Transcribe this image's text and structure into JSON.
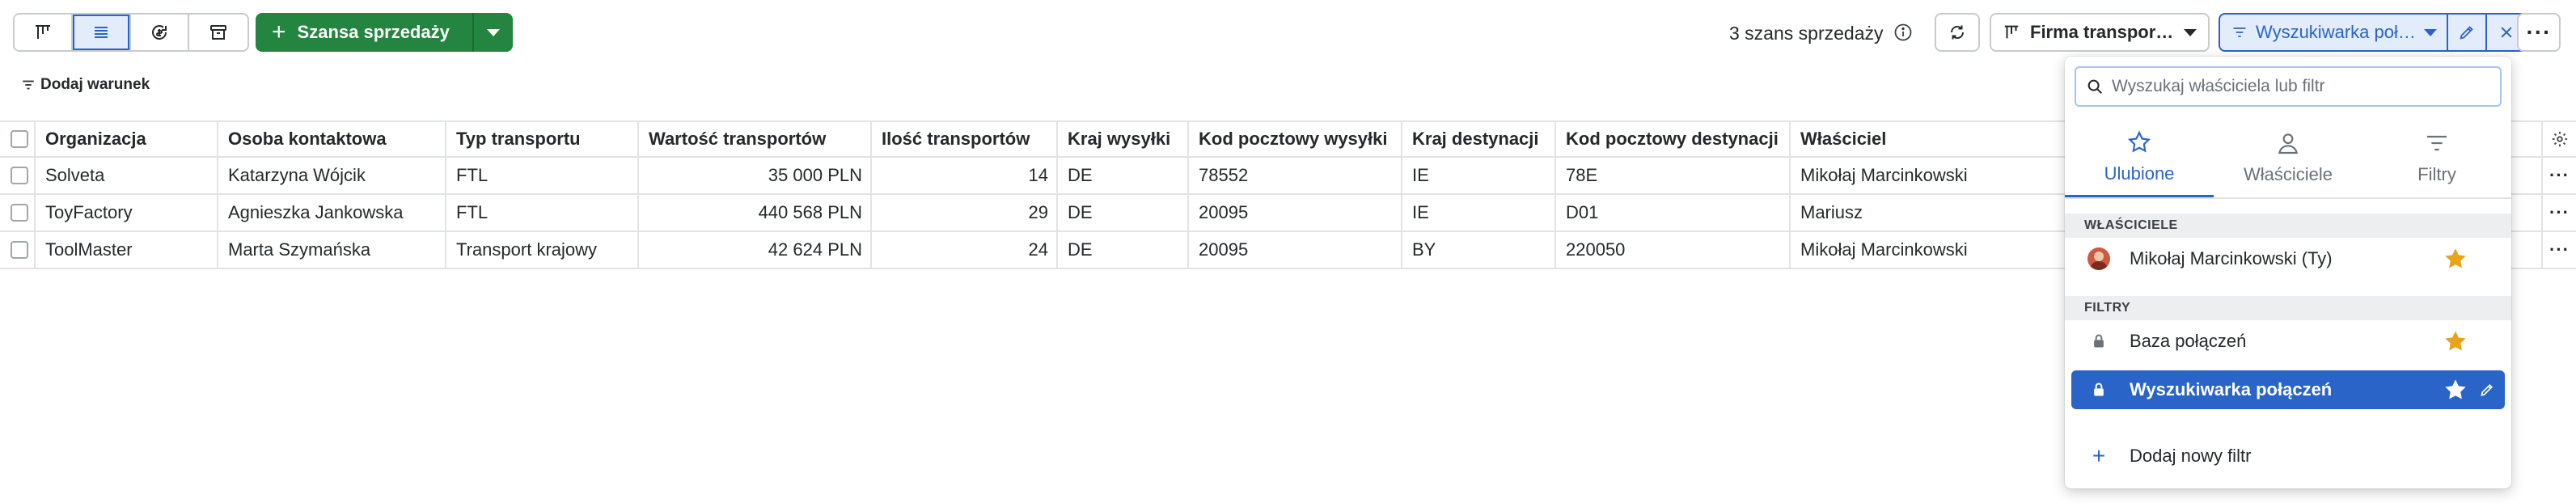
{
  "toolbar": {
    "views": [
      {
        "icon": "pipeline-board-icon",
        "active": false
      },
      {
        "icon": "list-view-icon",
        "active": true
      },
      {
        "icon": "forecast-icon",
        "active": false
      },
      {
        "icon": "archive-icon",
        "active": false
      }
    ],
    "add_deal_label": "Szansa sprzedaży",
    "deal_count": "3 szans sprzedaży",
    "pipeline_label": "Firma transportowa",
    "filter_label": "Wyszukiwarka połączeń",
    "more_label": "···"
  },
  "add_condition_label": "Dodaj warunek",
  "table": {
    "columns": [
      "Organizacja",
      "Osoba kontaktowa",
      "Typ transportu",
      "Wartość transportów",
      "Ilość transportów",
      "Kraj wysyłki",
      "Kod pocztowy wysyłki",
      "Kraj destynacji",
      "Kod pocztowy destynacji",
      "Właściciel"
    ],
    "rows": [
      [
        "Solveta",
        "Katarzyna Wójcik",
        "FTL",
        "35 000 PLN",
        "14",
        "DE",
        "78552",
        "IE",
        "78E",
        "Mikołaj Marcinkowski"
      ],
      [
        "ToyFactory",
        "Agnieszka Jankowska",
        "FTL",
        "440 568 PLN",
        "29",
        "DE",
        "20095",
        "IE",
        "D01",
        "Mariusz"
      ],
      [
        "ToolMaster",
        "Marta Szymańska",
        "Transport krajowy",
        "42 624 PLN",
        "24",
        "DE",
        "20095",
        "BY",
        "220050",
        "Mikołaj Marcinkowski"
      ]
    ],
    "row_menu_label": "···"
  },
  "panel": {
    "search_placeholder": "Wyszukaj właściciela lub filtr",
    "tabs": [
      {
        "label": "Ulubione",
        "icon": "star-outline-icon",
        "active": true
      },
      {
        "label": "Właściciele",
        "icon": "person-icon",
        "active": false
      },
      {
        "label": "Filtry",
        "icon": "filter-icon",
        "active": false
      }
    ],
    "owners_header": "WŁAŚCICIELE",
    "owners": [
      {
        "label": "Mikołaj Marcinkowski (Ty)",
        "favorite": true
      }
    ],
    "filters_header": "FILTRY",
    "filters": [
      {
        "label": "Baza połączeń",
        "favorite": true,
        "selected": false
      },
      {
        "label": "Wyszukiwarka połączeń",
        "favorite": true,
        "selected": true
      }
    ],
    "add_filter_label": "Dodaj nowy filtr"
  },
  "colors": {
    "primary_green": "#23853f",
    "accent_blue": "#2a64c8",
    "star_gold": "#e8a317"
  }
}
